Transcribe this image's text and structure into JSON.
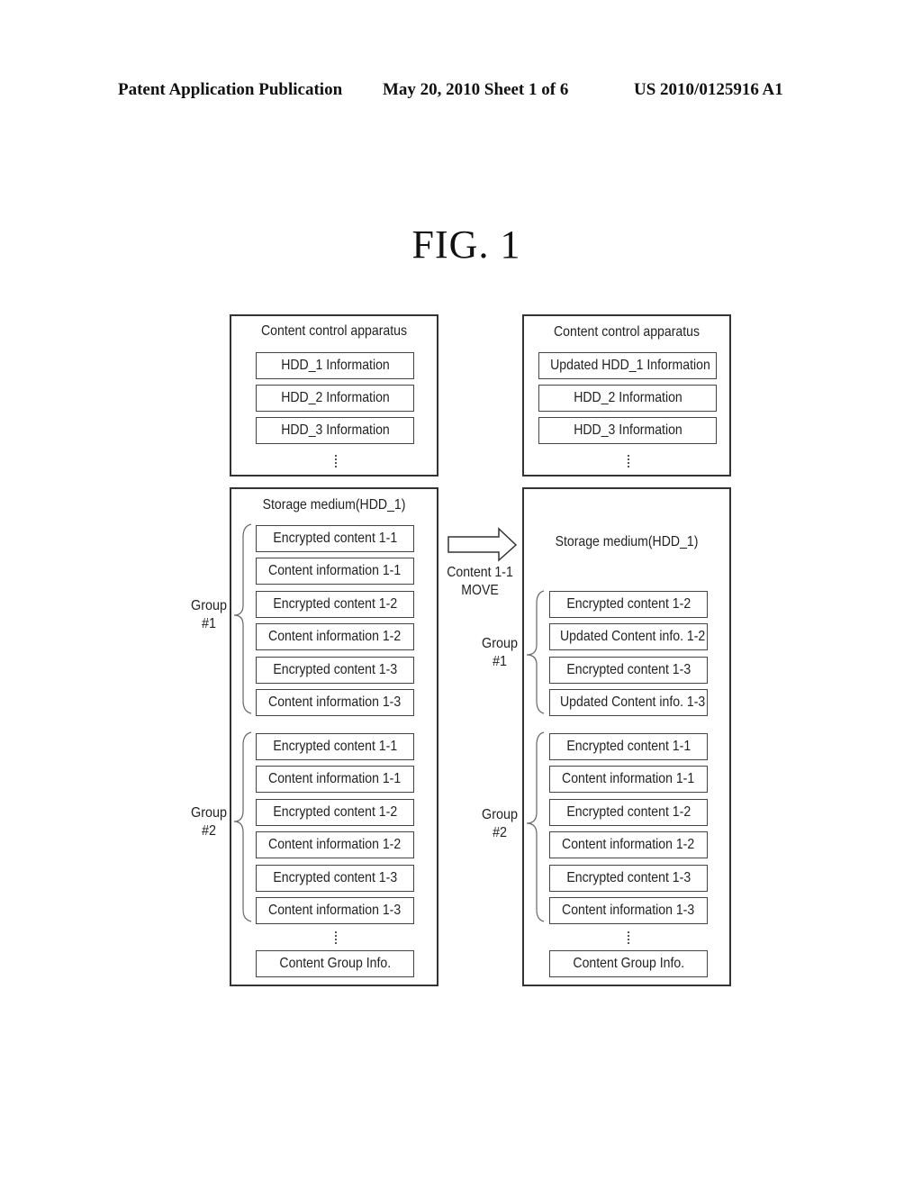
{
  "header": {
    "left": "Patent Application Publication",
    "center": "May 20, 2010  Sheet 1 of 6",
    "right": "US 2010/0125916 A1"
  },
  "figure_title": "FIG.  1",
  "before": {
    "apparatus": {
      "title": "Content control apparatus",
      "items": [
        "HDD_1 Information",
        "HDD_2 Information",
        "HDD_3 Information"
      ],
      "ellipsis": "⋮"
    },
    "storage": {
      "title": "Storage medium(HDD_1)",
      "groups": [
        {
          "label_line1": "Group",
          "label_line2": "#1",
          "items": [
            "Encrypted content 1-1",
            "Content information 1-1",
            "Encrypted content 1-2",
            "Content information 1-2",
            "Encrypted content 1-3",
            "Content information 1-3"
          ]
        },
        {
          "label_line1": "Group",
          "label_line2": "#2",
          "items": [
            "Encrypted content 1-1",
            "Content information 1-1",
            "Encrypted content 1-2",
            "Content information 1-2",
            "Encrypted content 1-3",
            "Content information 1-3"
          ]
        }
      ],
      "footer": "Content Group Info."
    }
  },
  "transition": {
    "label_line1": "Content 1-1",
    "label_line2": "MOVE"
  },
  "after": {
    "apparatus": {
      "title": "Content control apparatus",
      "items": [
        "Updated HDD_1 Information",
        "HDD_2 Information",
        "HDD_3 Information"
      ]
    },
    "storage": {
      "title": "Storage medium(HDD_1)",
      "groups": [
        {
          "label_line1": "Group",
          "label_line2": "#1",
          "items": [
            "Encrypted content 1-2",
            "Updated Content info. 1-2",
            "Encrypted content 1-3",
            "Updated Content info. 1-3"
          ]
        },
        {
          "label_line1": "Group",
          "label_line2": "#2",
          "items": [
            "Encrypted content 1-1",
            "Content information 1-1",
            "Encrypted content 1-2",
            "Content information 1-2",
            "Encrypted content 1-3",
            "Content information 1-3"
          ]
        }
      ],
      "footer": "Content Group Info."
    }
  }
}
